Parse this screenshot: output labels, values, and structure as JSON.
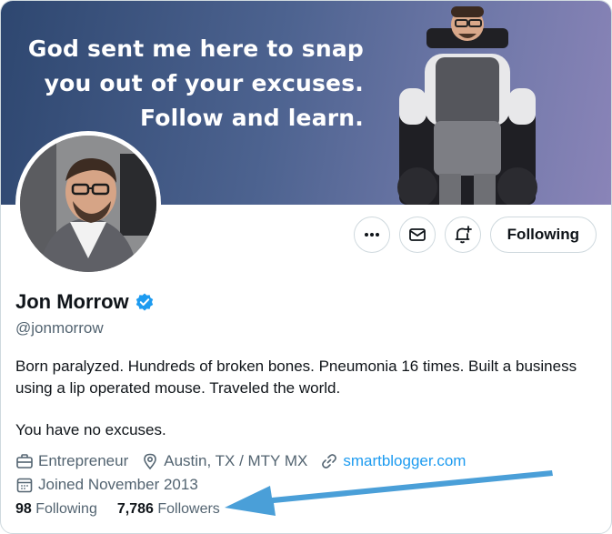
{
  "banner": {
    "quote_lines": [
      "God sent me here to snap",
      "you out of your excuses.",
      "Follow and learn."
    ]
  },
  "profile": {
    "name": "Jon Morrow",
    "handle": "@jonmorrow",
    "verified": true,
    "bio_lines": [
      "Born paralyzed. Hundreds of broken bones. Pneumonia 16 times. Built a business using a lip operated mouse. Traveled the world.",
      "You have no excuses."
    ],
    "occupation": "Entrepreneur",
    "location": "Austin, TX / MTY MX",
    "website": "smartblogger.com",
    "joined": "Joined November 2013"
  },
  "actions": {
    "more_icon": "more-icon",
    "message_icon": "envelope-icon",
    "notify_icon": "bell-plus-icon",
    "follow_label": "Following"
  },
  "stats": {
    "following_count": "98",
    "following_label": "Following",
    "followers_count": "7,786",
    "followers_label": "Followers"
  },
  "colors": {
    "accent": "#1d9bf0",
    "annotation_arrow": "#4a9fd8",
    "verified_badge": "#1d9bf0"
  }
}
